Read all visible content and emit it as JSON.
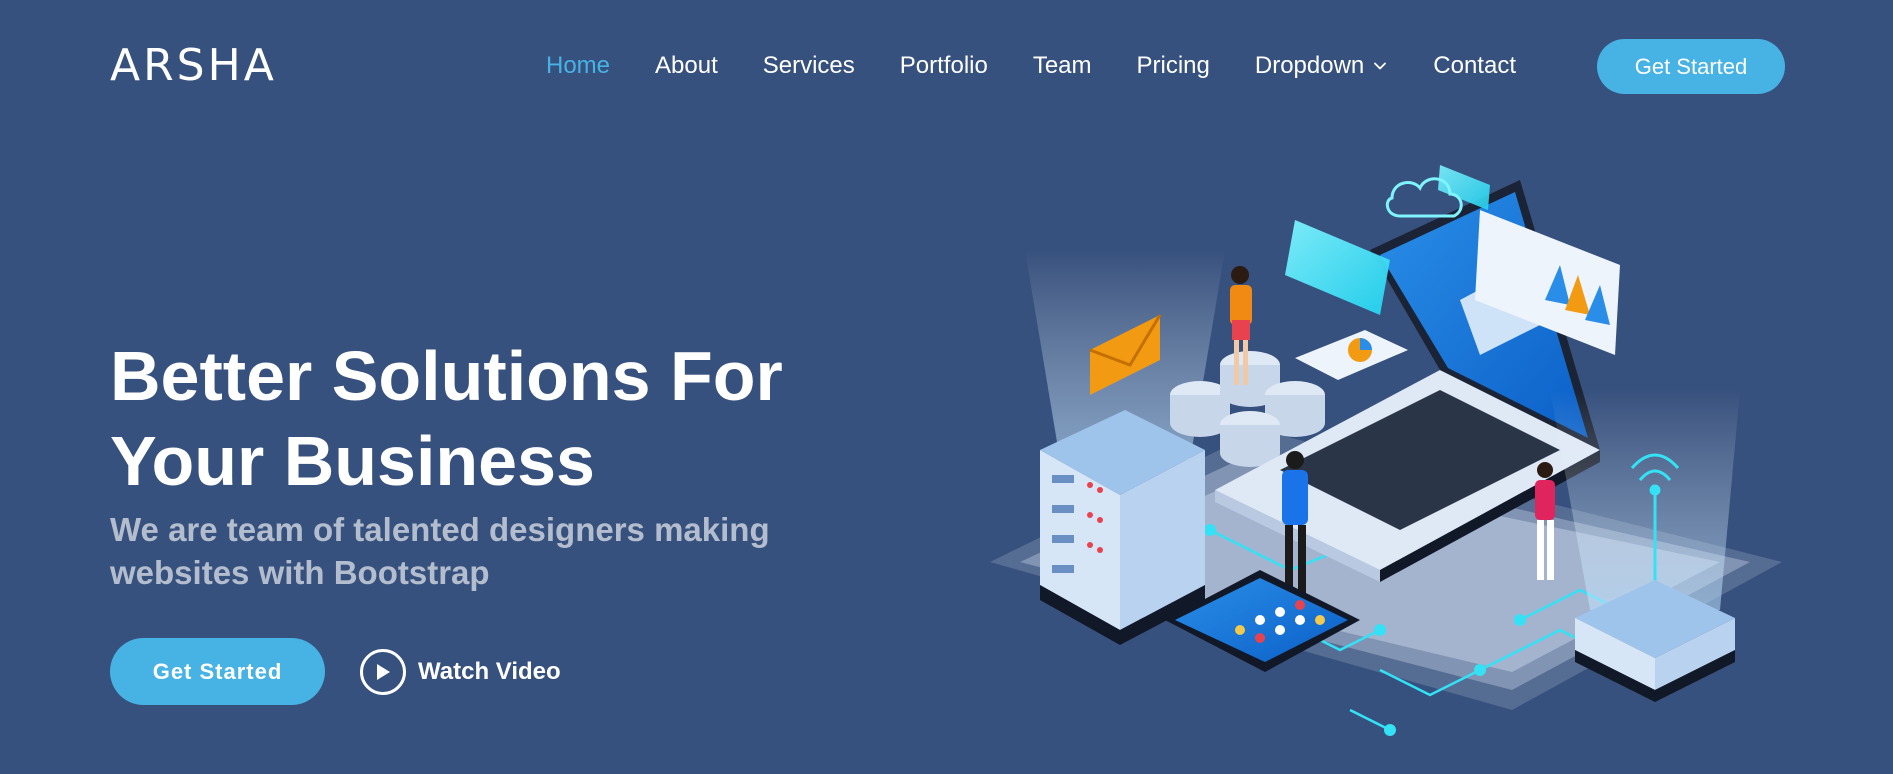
{
  "header": {
    "logo": "ARSHA",
    "nav": [
      {
        "label": "Home",
        "active": true
      },
      {
        "label": "About",
        "active": false
      },
      {
        "label": "Services",
        "active": false
      },
      {
        "label": "Portfolio",
        "active": false
      },
      {
        "label": "Team",
        "active": false
      },
      {
        "label": "Pricing",
        "active": false
      },
      {
        "label": "Dropdown",
        "active": false,
        "icon": "chevron-down-icon"
      },
      {
        "label": "Contact",
        "active": false
      }
    ],
    "cta_label": "Get Started"
  },
  "hero": {
    "title_line1": "Better Solutions For",
    "title_line2": "Your Business",
    "subtitle_line1": "We are team of talented designers making",
    "subtitle_line2": "websites with Bootstrap",
    "primary_button": "Get Started",
    "video_button": "Watch Video",
    "video_icon": "play-icon"
  },
  "colors": {
    "background": "#37517e",
    "accent": "#47b2e4",
    "text": "#ffffff"
  }
}
